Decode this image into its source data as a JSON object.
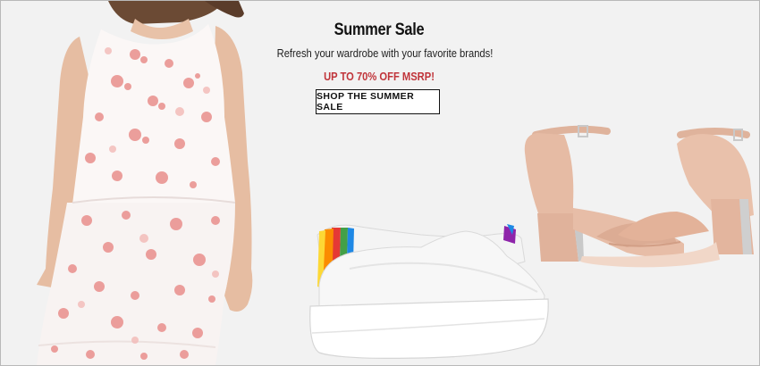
{
  "banner": {
    "title": "Summer Sale",
    "subtitle": "Refresh your wardrobe with your favorite brands!",
    "promo": "UP TO 70% OFF MSRP!",
    "cta_label": "SHOP THE SUMMER SALE",
    "colors": {
      "background": "#f2f2f2",
      "promo_text": "#c0343a",
      "cta_border": "#111111",
      "dress_print": "#e9888a",
      "sneaker": "#f5f5f5",
      "sandal": "#e3b69f"
    },
    "images": {
      "dress": "floral-dress-image",
      "sneaker": "white-sneaker-image",
      "sandal": "nude-block-heel-sandal-image"
    }
  }
}
